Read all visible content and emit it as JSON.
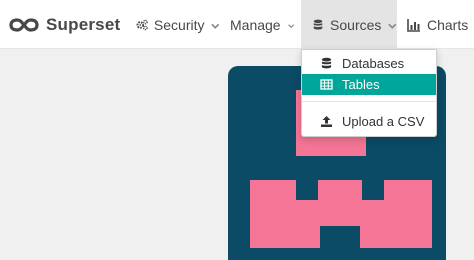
{
  "brand": {
    "name": "Superset",
    "logo_icon": "infinity-logo-icon"
  },
  "nav": {
    "security": {
      "label": "Security",
      "icon": "cogs-icon"
    },
    "manage": {
      "label": "Manage"
    },
    "sources": {
      "label": "Sources",
      "icon": "database-icon",
      "open": true
    },
    "charts": {
      "label": "Charts",
      "icon": "bar-chart-icon"
    }
  },
  "sources_menu": {
    "items": [
      {
        "label": "Databases",
        "icon": "database-icon"
      },
      {
        "label": "Tables",
        "icon": "table-icon",
        "highlighted": true
      },
      {
        "label": "Upload a CSV",
        "icon": "upload-icon"
      }
    ]
  },
  "colors": {
    "accent": "#00a699",
    "navbar_bg": "#ffffff",
    "page_bg": "#f0f0f0",
    "illustration_bg": "#0b4b66",
    "illustration_fg": "#f47595",
    "active_nav_bg": "#e4e4e4"
  }
}
